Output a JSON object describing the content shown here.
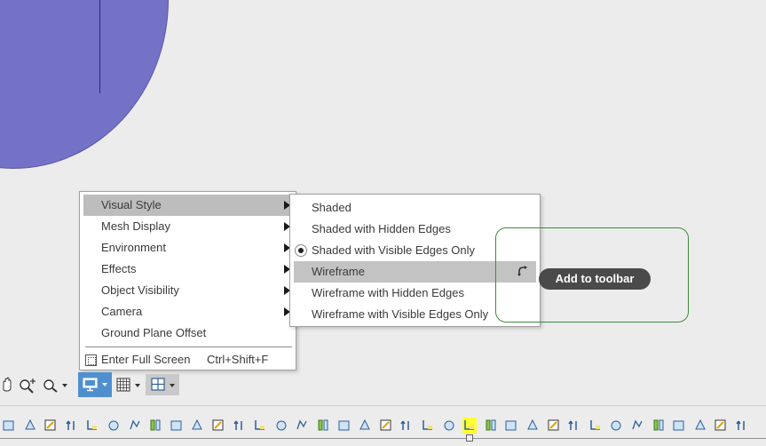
{
  "colors": {
    "model": "#7472c7",
    "menu_highlight": "#bdbdbd",
    "display_button": "#4f8fcf",
    "highlight_ring": "#3d8b3d",
    "tooltip_bg": "#4a4a4a",
    "timeline_selected": "#ffff33"
  },
  "display_menu": {
    "items": [
      {
        "label": "Visual Style",
        "submenu": true
      },
      {
        "label": "Mesh Display",
        "submenu": true
      },
      {
        "label": "Environment",
        "submenu": true
      },
      {
        "label": "Effects",
        "submenu": true
      },
      {
        "label": "Object Visibility",
        "submenu": true
      },
      {
        "label": "Camera",
        "submenu": true
      },
      {
        "label": "Ground Plane Offset",
        "submenu": false
      }
    ],
    "full_screen": {
      "label": "Enter Full Screen",
      "shortcut": "Ctrl+Shift+F",
      "icon": "fullscreen-icon"
    }
  },
  "visual_style_menu": {
    "items": [
      {
        "label": "Shaded"
      },
      {
        "label": "Shaded with Hidden Edges"
      },
      {
        "label": "Shaded with Visible Edges Only",
        "selected": true
      },
      {
        "label": "Wireframe",
        "hovered": true,
        "icon": "pin-icon"
      },
      {
        "label": "Wireframe with Hidden Edges"
      },
      {
        "label": "Wireframe with Visible Edges Only"
      }
    ]
  },
  "tooltip": {
    "label": "Add to toolbar"
  },
  "nav_bar": {
    "icons": [
      "pan-hand-icon",
      "zoom-window-icon",
      "zoom-icon",
      "display-settings-icon",
      "grid-icon",
      "viewports-icon"
    ]
  },
  "timeline": {
    "icon_count": 36,
    "selected_index": 22
  }
}
